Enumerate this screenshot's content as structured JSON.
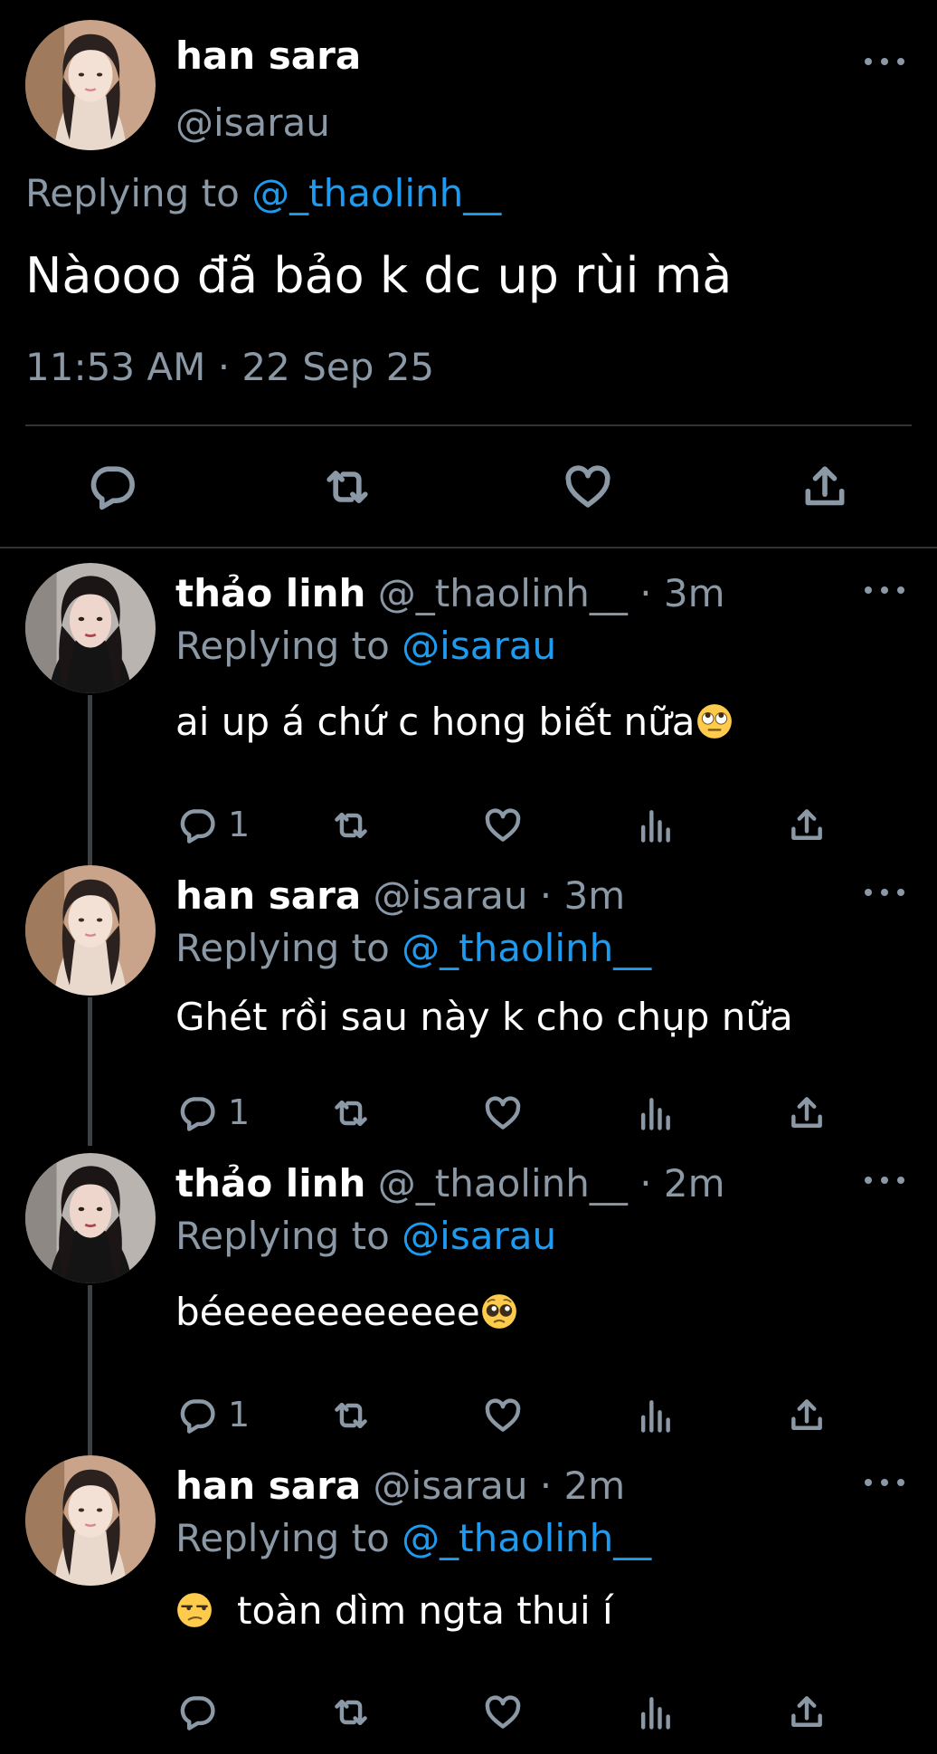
{
  "main_tweet": {
    "author": {
      "name": "han sara",
      "handle": "@isarau"
    },
    "replying_label": "Replying to",
    "replying_to": "@_thaolinh__",
    "text": "Nàooo đã bảo k dc up rùi mà",
    "timestamp": "11:53 AM · 22 Sep 25",
    "actions": {
      "icons": [
        "reply-icon",
        "retweet-icon",
        "like-icon",
        "share-icon"
      ]
    }
  },
  "replies": [
    {
      "name": "thảo linh",
      "meta": "@_thaolinh__ · 3m",
      "replying_label": "Replying to",
      "replying_to": "@isarau",
      "text": "ai up á chứ c hong biết nữa",
      "emoji": "face-with-rolling-eyes",
      "reply_count": "1"
    },
    {
      "name": "han sara",
      "meta": "@isarau · 3m",
      "replying_label": "Replying to",
      "replying_to": "@_thaolinh__",
      "text": "Ghét rồi sau này k cho chụp nữa",
      "reply_count": "1"
    },
    {
      "name": "thảo linh",
      "meta": "@_thaolinh__ · 2m",
      "replying_label": "Replying to",
      "replying_to": "@isarau",
      "text": "béeeeeeeeeeee",
      "emoji": "pleading-face",
      "reply_count": "1"
    },
    {
      "name": "han sara",
      "meta": "@isarau · 2m",
      "replying_label": "Replying to",
      "replying_to": "@_thaolinh__",
      "text": "toàn dìm ngta thui í",
      "emoji": "unamused-face"
    }
  ],
  "reply_action_icons": [
    "reply-icon",
    "retweet-icon",
    "like-icon",
    "views-icon",
    "share-icon"
  ],
  "colors": {
    "background": "#000000",
    "text": "#ffffff",
    "secondary_text": "#8b98a5",
    "mention": "#1d9bf0",
    "divider": "#2f3336"
  }
}
